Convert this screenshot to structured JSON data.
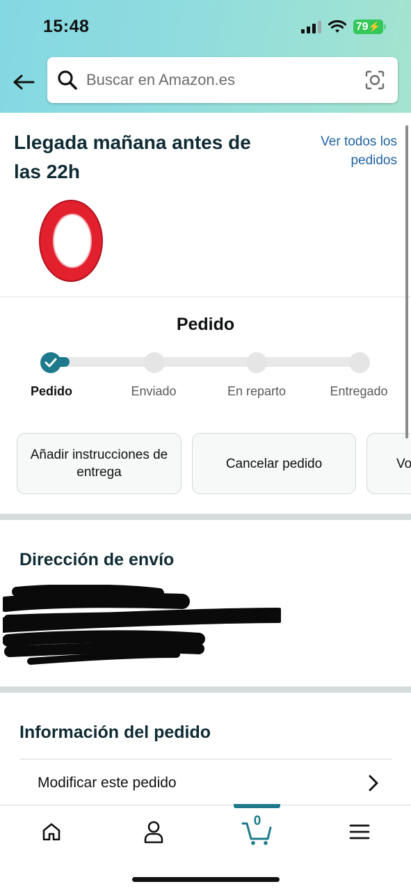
{
  "status_bar": {
    "time": "15:48",
    "battery": "79"
  },
  "search": {
    "placeholder": "Buscar en Amazon.es"
  },
  "delivery": {
    "title": "Llegada mañana antes de las 22h",
    "view_all_orders": "Ver todos los pedidos"
  },
  "progress": {
    "heading": "Pedido",
    "current_step": 1,
    "steps": [
      {
        "label": "Pedido"
      },
      {
        "label": "Enviado"
      },
      {
        "label": "En reparto"
      },
      {
        "label": "Entregado"
      }
    ]
  },
  "actions": [
    {
      "label": "Añadir instrucciones de entrega"
    },
    {
      "label": "Cancelar pedido"
    },
    {
      "label": "Vo"
    }
  ],
  "shipping": {
    "title": "Dirección de envío"
  },
  "order_info": {
    "title": "Información del pedido",
    "modify_label": "Modificar este pedido"
  },
  "bottom_nav": {
    "items": [
      {
        "icon": "home-icon"
      },
      {
        "icon": "account-icon"
      },
      {
        "icon": "cart-icon",
        "count": "0",
        "selected": true
      },
      {
        "icon": "menu-icon"
      }
    ]
  },
  "colors": {
    "accent": "#1d7a8c",
    "link": "#2162a1",
    "header_gradient_start": "#84d8e3",
    "header_gradient_end": "#a4e4cf"
  }
}
